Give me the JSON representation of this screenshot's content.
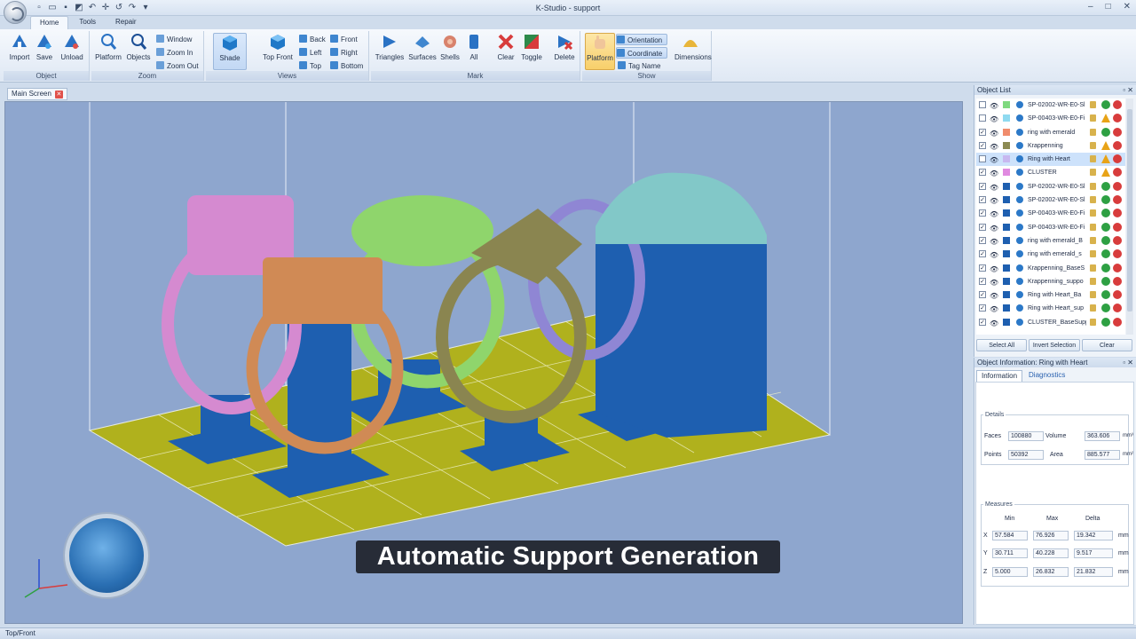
{
  "window": {
    "title": "K-Studio - support",
    "minimize": "–",
    "maximize": "□",
    "close": "✕"
  },
  "ribbon": {
    "tabs": [
      {
        "label": "Home",
        "active": true
      },
      {
        "label": "Tools",
        "active": false
      },
      {
        "label": "Repair",
        "active": false
      }
    ],
    "groups": {
      "object": {
        "label": "Object",
        "buttons": [
          "Import",
          "Save",
          "Unload"
        ]
      },
      "zoom": {
        "label": "Zoom",
        "buttons": [
          "Platform",
          "Objects"
        ],
        "small": [
          "Window",
          "Zoom In",
          "Zoom Out"
        ]
      },
      "views": {
        "label": "Views",
        "shade": "Shade",
        "top_front": "Top Front",
        "small": [
          "Back",
          "Left",
          "Top",
          "Front",
          "Right",
          "Bottom"
        ]
      },
      "mark": {
        "label": "Mark",
        "buttons": [
          "Triangles",
          "Surfaces",
          "Shells",
          "All",
          "Clear",
          "Toggle",
          "Delete"
        ]
      },
      "show": {
        "label": "Show",
        "platform": "Platform",
        "small": [
          "Orientation",
          "Coordinate",
          "Tag Name"
        ],
        "dimensions": "Dimensions"
      }
    }
  },
  "document_tab": {
    "label": "Main Screen"
  },
  "viewport": {
    "caption": "Automatic Support Generation",
    "colors": {
      "background": "#8ea6ce",
      "platform": "#b0b11d",
      "supports": "#1e5fb0",
      "ring_pink": "#d58ad0",
      "ring_copper": "#d08a55",
      "ring_green": "#8fd56c",
      "ring_olive": "#8a8550",
      "ring_lavender": "#8f86d4",
      "ring_teal": "#82c8c8"
    }
  },
  "object_list": {
    "title": "Object List",
    "items": [
      {
        "name": "SP-02002-WR-E0-Sl",
        "checked": false,
        "swatch": "#7fd97f",
        "status": "ok"
      },
      {
        "name": "SP-00403-WR-E0-Fi",
        "checked": false,
        "swatch": "#8fdaf0",
        "status": "warn"
      },
      {
        "name": "ring with emerald",
        "checked": true,
        "swatch": "#f08c6c",
        "status": "ok"
      },
      {
        "name": "Krappenning",
        "checked": true,
        "swatch": "#8c8a52",
        "status": "warn"
      },
      {
        "name": "Ring with Heart",
        "checked": false,
        "swatch": "#c7b8f0",
        "status": "warn",
        "selected": true
      },
      {
        "name": "CLUSTER",
        "checked": true,
        "swatch": "#e08ae0",
        "status": "warn"
      },
      {
        "name": "SP-02002-WR-E0-Sl",
        "checked": true,
        "swatch": "#1e5fb0",
        "status": "ok"
      },
      {
        "name": "SP-02002-WR-E0-Sl",
        "checked": true,
        "swatch": "#1e5fb0",
        "status": "ok"
      },
      {
        "name": "SP-00403-WR-E0-Fi",
        "checked": true,
        "swatch": "#1e5fb0",
        "status": "ok"
      },
      {
        "name": "SP-00403-WR-E0-Fi",
        "checked": true,
        "swatch": "#1e5fb0",
        "status": "ok"
      },
      {
        "name": "ring with emerald_B",
        "checked": true,
        "swatch": "#1e5fb0",
        "status": "ok"
      },
      {
        "name": "ring with emerald_s",
        "checked": true,
        "swatch": "#1e5fb0",
        "status": "ok"
      },
      {
        "name": "Krappenning_BaseS",
        "checked": true,
        "swatch": "#1e5fb0",
        "status": "ok"
      },
      {
        "name": "Krappenning_suppo",
        "checked": true,
        "swatch": "#1e5fb0",
        "status": "ok"
      },
      {
        "name": "Ring with Heart_Ba",
        "checked": true,
        "swatch": "#1e5fb0",
        "status": "ok"
      },
      {
        "name": "Ring with Heart_sup",
        "checked": true,
        "swatch": "#1e5fb0",
        "status": "ok"
      },
      {
        "name": "CLUSTER_BaseSupp",
        "checked": true,
        "swatch": "#1e5fb0",
        "status": "ok"
      }
    ],
    "buttons": [
      "Select All",
      "Invert Selection",
      "Clear"
    ]
  },
  "object_info": {
    "title": "Object Information: Ring with Heart",
    "tabs": [
      "Information",
      "Diagnostics"
    ],
    "details": {
      "legend": "Details",
      "faces_label": "Faces",
      "faces": "100880",
      "volume_label": "Volume",
      "volume": "363.606",
      "volume_unit": "mm³",
      "points_label": "Points",
      "points": "50392",
      "area_label": "Area",
      "area": "885.577",
      "area_unit": "mm²"
    },
    "measures": {
      "legend": "Measures",
      "headers": [
        "Min",
        "Max",
        "Delta"
      ],
      "rows": [
        {
          "axis": "X",
          "min": "57.584",
          "max": "76.926",
          "delta": "19.342",
          "unit": "mm"
        },
        {
          "axis": "Y",
          "min": "30.711",
          "max": "40.228",
          "delta": "9.517",
          "unit": "mm"
        },
        {
          "axis": "Z",
          "min": "5.000",
          "max": "26.832",
          "delta": "21.832",
          "unit": "mm"
        }
      ]
    }
  },
  "status_bar": {
    "text": "Top/Front"
  }
}
